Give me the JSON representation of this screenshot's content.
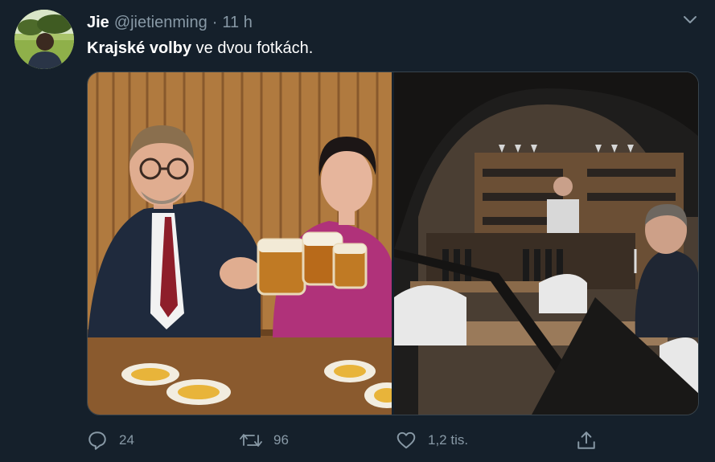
{
  "tweet": {
    "display_name": "Jie",
    "handle": "@jietienming",
    "separator": "·",
    "time": "11 h",
    "text_bold": "Krajské volby",
    "text_rest": " ve dvou fotkách."
  },
  "actions": {
    "reply_count": "24",
    "retweet_count": "96",
    "like_count": "1,2 tis."
  },
  "icons": {
    "avatar": "profile-photo",
    "menu": "chevron-down-icon",
    "reply": "reply-icon",
    "retweet": "retweet-icon",
    "like": "heart-icon",
    "share": "share-icon"
  },
  "colors": {
    "background": "#15202b",
    "text_primary": "#ffffff",
    "text_secondary": "#8899a6",
    "border": "#38444d"
  }
}
